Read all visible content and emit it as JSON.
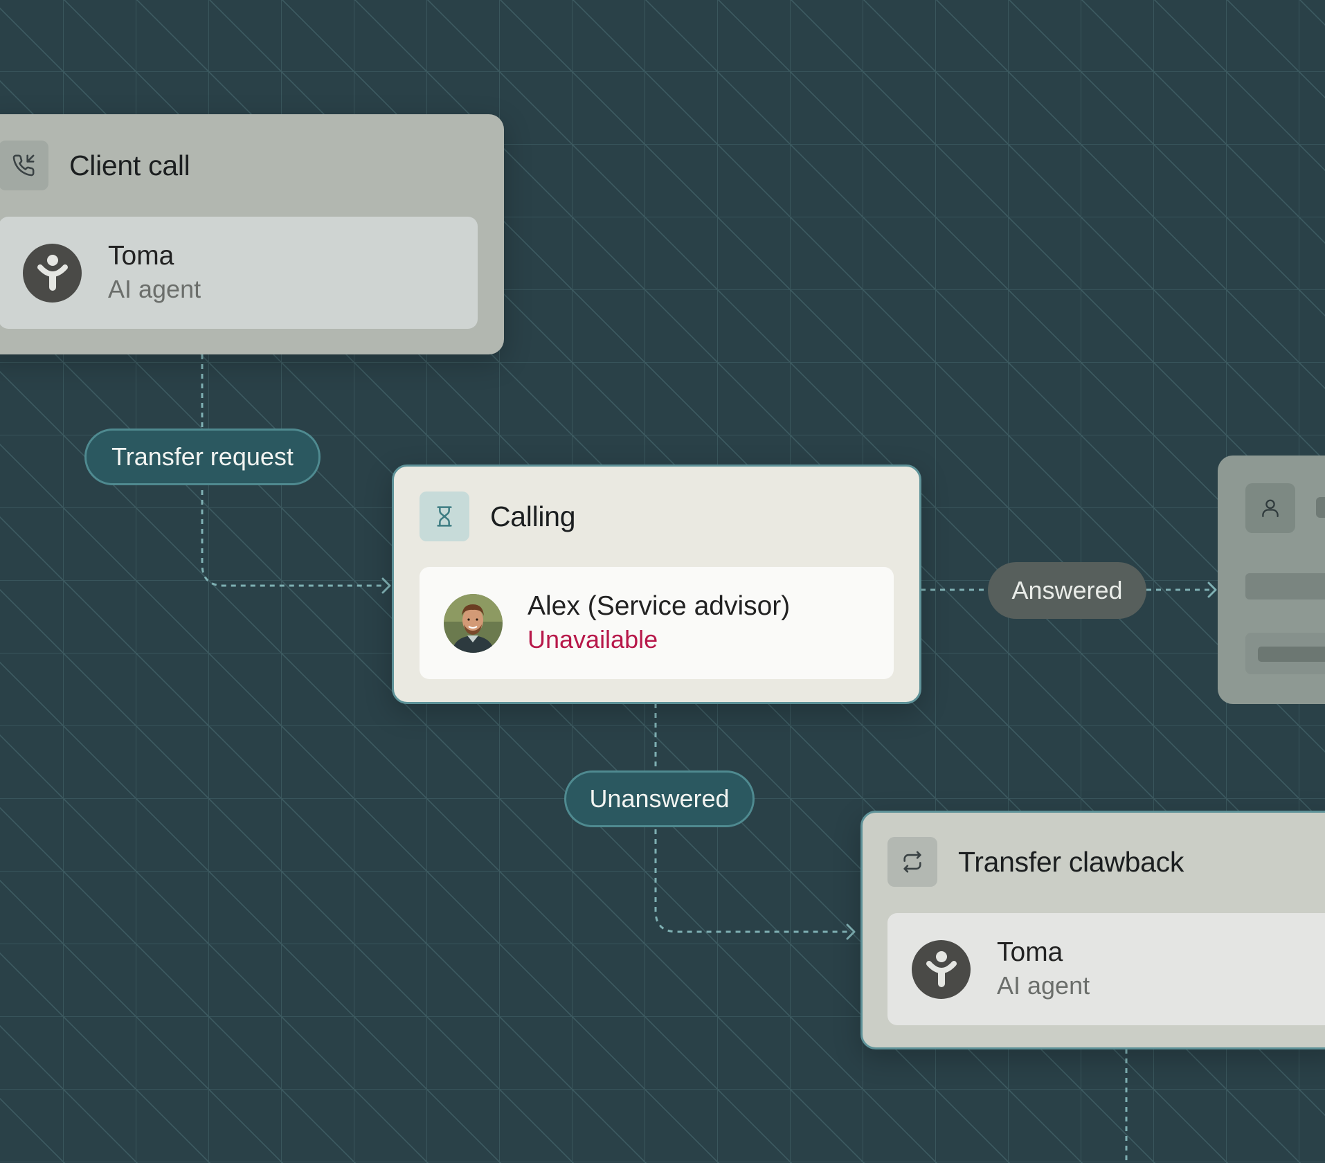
{
  "client_call": {
    "title": "Client call",
    "icon": "phone-incoming-icon",
    "agent": {
      "name": "Toma",
      "role": "AI agent",
      "icon": "ai-agent-icon"
    }
  },
  "transfer_request": {
    "label": "Transfer request"
  },
  "calling": {
    "title": "Calling",
    "icon": "hourglass-icon",
    "contact": {
      "name": "Alex (Service advisor)",
      "status": "Unavailable"
    }
  },
  "answered": {
    "label": "Answered"
  },
  "answered_target": {
    "icon": "user-icon"
  },
  "unanswered": {
    "label": "Unanswered"
  },
  "transfer_clawback": {
    "title": "Transfer clawback",
    "icon": "repeat-icon",
    "agent": {
      "name": "Toma",
      "role": "AI agent",
      "icon": "ai-agent-icon"
    }
  },
  "colors": {
    "background": "#2a4148",
    "unavailable": "#b7184a",
    "pill_teal": "#2b5860",
    "active_card_border": "#4f8a90"
  }
}
